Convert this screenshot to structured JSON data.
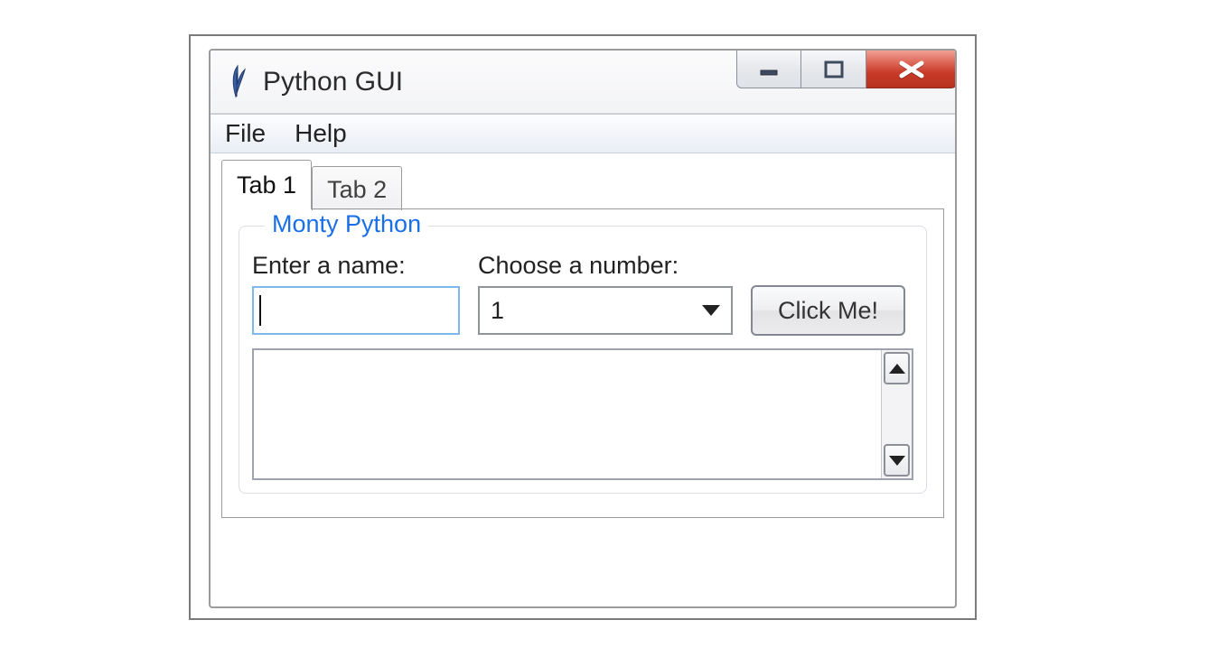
{
  "window": {
    "title": "Python GUI",
    "app_icon": "feather-icon"
  },
  "menubar": {
    "items": [
      "File",
      "Help"
    ]
  },
  "tabs": {
    "items": [
      "Tab 1",
      "Tab 2"
    ],
    "active_index": 0
  },
  "frame": {
    "title": "Monty Python",
    "name_label": "Enter a name:",
    "number_label": "Choose a number:",
    "name_value": "",
    "number_value": "1",
    "button_label": "Click Me!"
  }
}
